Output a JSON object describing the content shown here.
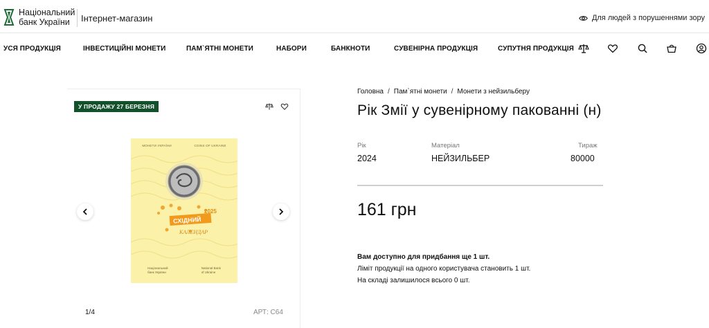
{
  "header": {
    "logo_line1": "Національний",
    "logo_line2": "банк України",
    "store_title": "Інтернет-магазин",
    "accessibility_label": "Для людей з порушеннями зору"
  },
  "nav": {
    "items": [
      "УСЯ ПРОДУКЦІЯ",
      "ІНВЕСТИЦІЙНІ МОНЕТИ",
      "ПАМ`ЯТНІ МОНЕТИ",
      "НАБОРИ",
      "БАНКНОТИ",
      "СУВЕНІРНА ПРОДУКЦІЯ",
      "СУПУТНЯ ПРОДУКЦІЯ"
    ],
    "icons": [
      "compare-icon",
      "heart-icon",
      "search-icon",
      "cart-icon",
      "user-icon"
    ]
  },
  "gallery": {
    "badge": "У ПРОДАЖУ 27 БЕРЕЗНЯ",
    "counter": "1/4",
    "sku": "АРТ: С64",
    "packaging": {
      "top_left": "МОНЕТИ УКРАЇНИ",
      "top_right": "COINS OF UKRAINE",
      "year": "2025",
      "word1": "СХІДНИЙ",
      "word2": "КАЛЕНДАР",
      "bottom_left_1": "Національний",
      "bottom_left_2": "банк України",
      "bottom_right_1": "National Bank",
      "bottom_right_2": "of Ukraine"
    }
  },
  "breadcrumb": [
    "Головна",
    "Пам`ятні монети",
    "Монети з нейзильберу"
  ],
  "product": {
    "title": "Рік Змії у сувенірному пакованні (н)",
    "specs": {
      "year_label": "Рік",
      "year_value": "2024",
      "material_label": "Матеріал",
      "material_value": "НЕЙЗИЛЬБЕР",
      "mintage_label": "Тираж",
      "mintage_value": "80000"
    },
    "price": "161 грн",
    "availability": "Вам доступно для придбання ще 1 шт.",
    "limit": "Ліміт продукції на одного користувача становить 1 шт.",
    "stock": "На складі залишилося всього 0 шт."
  },
  "colors": {
    "brand_green": "#12512a",
    "package_yellow": "#fbf1a8",
    "accent_orange": "#f29a1b"
  }
}
